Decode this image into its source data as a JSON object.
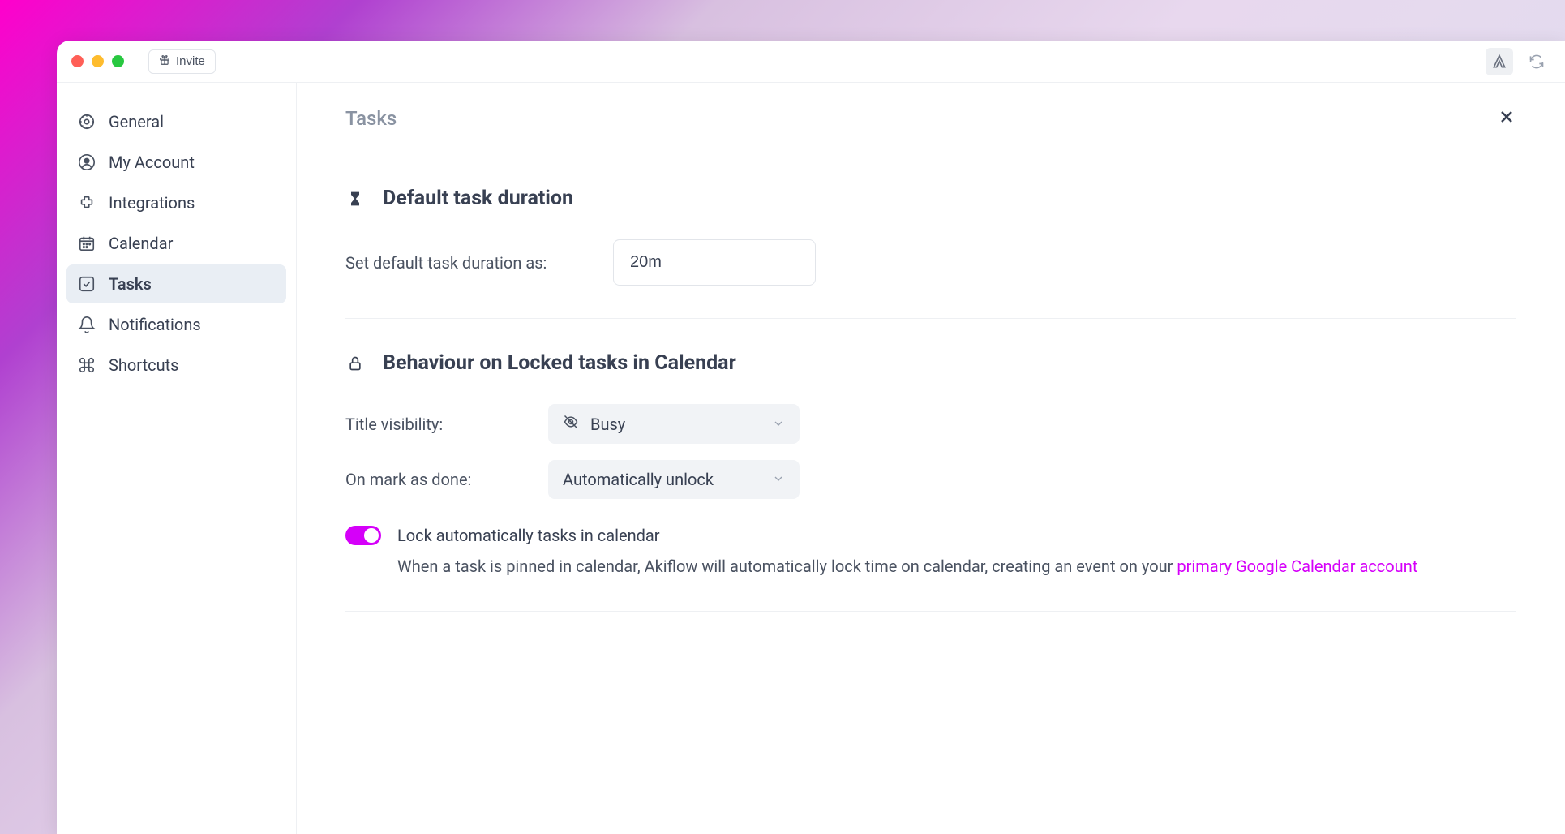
{
  "titlebar": {
    "invite_label": "Invite"
  },
  "sidebar": {
    "items": [
      {
        "label": "General"
      },
      {
        "label": "My Account"
      },
      {
        "label": "Integrations"
      },
      {
        "label": "Calendar"
      },
      {
        "label": "Tasks"
      },
      {
        "label": "Notifications"
      },
      {
        "label": "Shortcuts"
      }
    ]
  },
  "main": {
    "title": "Tasks",
    "section_duration": {
      "title": "Default task duration",
      "label": "Set default task duration as:",
      "value": "20m"
    },
    "section_locked": {
      "title": "Behaviour on Locked tasks in Calendar",
      "title_visibility_label": "Title visibility:",
      "title_visibility_value": "Busy",
      "on_done_label": "On mark as done:",
      "on_done_value": "Automatically unlock",
      "toggle_title": "Lock automatically tasks in calendar",
      "toggle_desc_prefix": "When a task is pinned in calendar, Akiflow will automatically lock time on calendar, creating an event on your ",
      "toggle_link": "primary Google Calendar account"
    }
  }
}
